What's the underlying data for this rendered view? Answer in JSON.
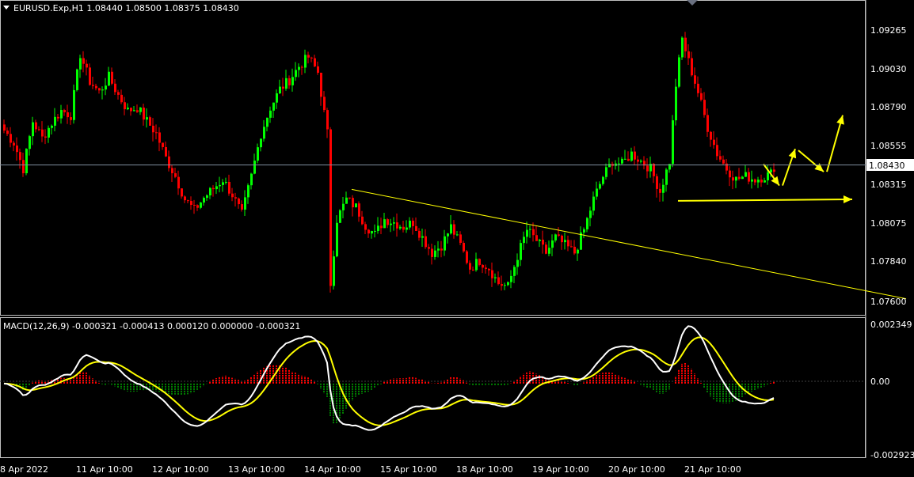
{
  "header": {
    "symbol_line": "EURUSD.Exp,H1  1.08440 1.08500 1.08375 1.08430",
    "menu_icon": "triangle-down-icon"
  },
  "price_axis": {
    "labels": [
      "1.09265",
      "1.09030",
      "1.08790",
      "1.08555",
      "1.08315",
      "1.08075",
      "1.07840",
      "1.07600"
    ],
    "current_price": "1.08430"
  },
  "macd": {
    "title": "MACD(12,26,9) -0.000321 -0.000413 0.000120 0.000000 -0.000321",
    "axis_labels": [
      "0.002349",
      "0.00",
      "-0.002923"
    ]
  },
  "time_axis": {
    "labels": [
      "8 Apr 2022",
      "11 Apr 10:00",
      "12 Apr 10:00",
      "13 Apr 10:00",
      "14 Apr 10:00",
      "15 Apr 10:00",
      "18 Apr 10:00",
      "19 Apr 10:00",
      "20 Apr 10:00",
      "21 Apr 10:00"
    ]
  },
  "colors": {
    "background": "#000000",
    "bull": "#00ff00",
    "bear": "#ff0000",
    "grid_line": "#c0c0c0",
    "macd_line": "#ffffff",
    "signal_line": "#ffff00",
    "hist_pos": "#ff0000",
    "hist_neg": "#008000",
    "drawing": "#ffff00"
  },
  "chart_data": {
    "type": "candlestick",
    "symbol": "EURUSD.Exp",
    "timeframe": "H1",
    "ohlc_last": {
      "open": 1.0844,
      "high": 1.085,
      "low": 1.08375,
      "close": 1.0843
    },
    "ylim": [
      1.0751,
      1.0945
    ],
    "path": [
      [
        0,
        1.087
      ],
      [
        3,
        1.0862
      ],
      [
        6,
        1.0845
      ],
      [
        9,
        1.0876
      ],
      [
        12,
        1.0865
      ],
      [
        15,
        1.0875
      ],
      [
        18,
        1.0883
      ],
      [
        21,
        1.088
      ],
      [
        24,
        1.092
      ],
      [
        27,
        1.0902
      ],
      [
        30,
        1.0895
      ],
      [
        33,
        1.0905
      ],
      [
        36,
        1.0893
      ],
      [
        39,
        1.0883
      ],
      [
        42,
        1.0885
      ],
      [
        45,
        1.0876
      ],
      [
        48,
        1.0868
      ],
      [
        51,
        1.0852
      ],
      [
        54,
        1.084
      ],
      [
        57,
        1.0825
      ],
      [
        60,
        1.0818
      ],
      [
        63,
        1.0826
      ],
      [
        66,
        1.0832
      ],
      [
        69,
        1.0838
      ],
      [
        72,
        1.0828
      ],
      [
        75,
        1.0815
      ],
      [
        78,
        1.084
      ],
      [
        81,
        1.0868
      ],
      [
        84,
        1.0885
      ],
      [
        87,
        1.0897
      ],
      [
        90,
        1.0903
      ],
      [
        93,
        1.0912
      ],
      [
        96,
        1.0918
      ],
      [
        99,
        1.0908
      ],
      [
        102,
        1.0868
      ],
      [
        103,
        1.077
      ],
      [
        105,
        1.0812
      ],
      [
        108,
        1.0825
      ],
      [
        111,
        1.082
      ],
      [
        114,
        1.0808
      ],
      [
        117,
        1.0802
      ],
      [
        120,
        1.0812
      ],
      [
        123,
        1.081
      ],
      [
        126,
        1.0807
      ],
      [
        129,
        1.081
      ],
      [
        132,
        1.08
      ],
      [
        135,
        1.079
      ],
      [
        138,
        1.0795
      ],
      [
        141,
        1.0807
      ],
      [
        144,
        1.0795
      ],
      [
        147,
        1.078
      ],
      [
        150,
        1.0785
      ],
      [
        153,
        1.078
      ],
      [
        156,
        1.077
      ],
      [
        159,
        1.0768
      ],
      [
        162,
        1.0788
      ],
      [
        165,
        1.0805
      ],
      [
        168,
        1.0798
      ],
      [
        171,
        1.079
      ],
      [
        174,
        1.08
      ],
      [
        177,
        1.0795
      ],
      [
        180,
        1.079
      ],
      [
        183,
        1.0805
      ],
      [
        186,
        1.0825
      ],
      [
        189,
        1.084
      ],
      [
        192,
        1.085
      ],
      [
        195,
        1.0848
      ],
      [
        198,
        1.0855
      ],
      [
        201,
        1.085
      ],
      [
        204,
        1.0845
      ],
      [
        207,
        1.083
      ],
      [
        210,
        1.085
      ],
      [
        212,
        1.09
      ],
      [
        214,
        1.093
      ],
      [
        216,
        1.0915
      ],
      [
        219,
        1.0895
      ],
      [
        222,
        1.0872
      ],
      [
        225,
        1.0855
      ],
      [
        228,
        1.0845
      ],
      [
        231,
        1.0838
      ],
      [
        234,
        1.084
      ],
      [
        237,
        1.0838
      ],
      [
        240,
        1.084
      ],
      [
        243,
        1.0843
      ]
    ],
    "annotations": [
      {
        "type": "trendline",
        "from": [
          110,
          1.08315
        ],
        "to": [
          285,
          1.076
        ]
      },
      {
        "type": "arrow",
        "from": [
          213,
          1.0824
        ],
        "to": [
          268,
          1.0825
        ]
      },
      {
        "type": "arrow_path",
        "points": [
          [
            240,
            1.0848
          ],
          [
            245,
            1.0834
          ]
        ]
      },
      {
        "type": "arrow_path",
        "points": [
          [
            246,
            1.0834
          ],
          [
            250,
            1.0858
          ]
        ]
      },
      {
        "type": "arrow_path",
        "points": [
          [
            251,
            1.0857
          ],
          [
            259,
            1.0843
          ]
        ]
      },
      {
        "type": "arrow_path",
        "points": [
          [
            260,
            1.0843
          ],
          [
            265,
            1.088
          ]
        ]
      }
    ],
    "macd": {
      "ylim": [
        -0.002923,
        0.002349
      ],
      "params": [
        12,
        26,
        9
      ],
      "values": {
        "macd": -0.000321,
        "signal": -0.000413,
        "hist": 0.00012
      }
    }
  }
}
